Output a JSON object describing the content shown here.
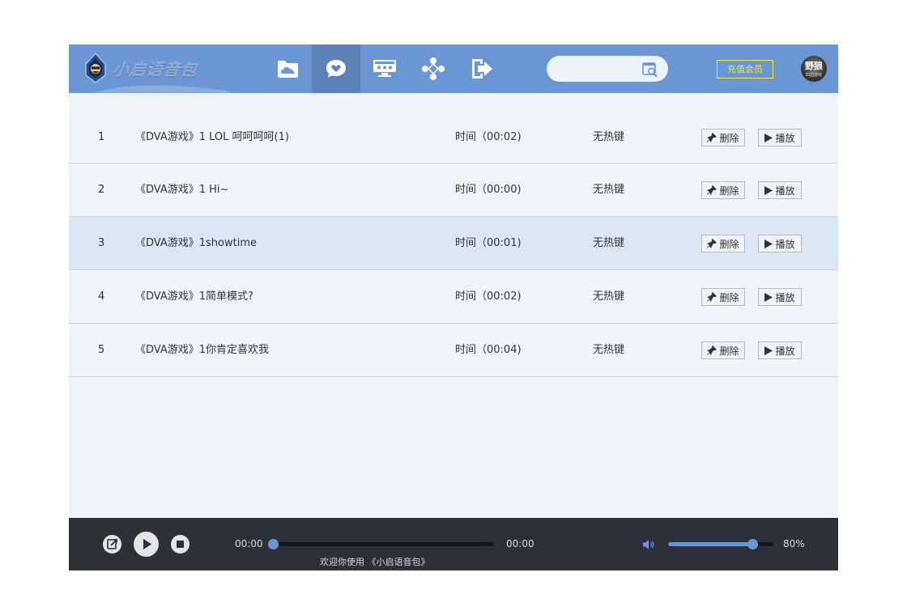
{
  "header": {
    "logo_text": "小启语音包",
    "nav": [
      {
        "icon": "cloud-folder-icon",
        "active": false
      },
      {
        "icon": "heart-chat-icon",
        "active": true
      },
      {
        "icon": "monitor-icon",
        "active": false
      },
      {
        "icon": "gamepad-icon",
        "active": false
      },
      {
        "icon": "exit-icon",
        "active": false
      }
    ],
    "search": {
      "value": "",
      "placeholder": ""
    },
    "recharge_label": "充值会员",
    "avatar_text": "野狼",
    "avatar_subtext": "四国游戏"
  },
  "list": {
    "rows": [
      {
        "index": "1",
        "name": "《DVA游戏》1 LOL 呵呵呵呵(1)",
        "time": "时间（00:02)",
        "hotkey": "无热键",
        "delete_label": "删除",
        "play_label": "播放"
      },
      {
        "index": "2",
        "name": "《DVA游戏》1 Hi~",
        "time": "时间（00:00)",
        "hotkey": "无热键",
        "delete_label": "删除",
        "play_label": "播放"
      },
      {
        "index": "3",
        "name": "《DVA游戏》1showtime",
        "time": "时间（00:01)",
        "hotkey": "无热键",
        "delete_label": "删除",
        "play_label": "播放"
      },
      {
        "index": "4",
        "name": "《DVA游戏》1简单模式?",
        "time": "时间（00:02)",
        "hotkey": "无热键",
        "delete_label": "删除",
        "play_label": "播放"
      },
      {
        "index": "5",
        "name": "《DVA游戏》1你肯定喜欢我",
        "time": "时间（00:04)",
        "hotkey": "无热键",
        "delete_label": "删除",
        "play_label": "播放"
      }
    ],
    "highlighted_row": 3
  },
  "player": {
    "current_time": "00:00",
    "total_time": "00:00",
    "progress": 0,
    "welcome_text": "欢迎你使用 《小启语音包》",
    "volume": 0.8,
    "volume_label": "80%"
  },
  "colors": {
    "header_bg": "#6a96d3",
    "nav_active_bg": "#5b83ba",
    "list_bg": "#eff4fb",
    "row_highlight": "#dae6f4",
    "player_bg": "#2c3038",
    "accent": "#6a96d3",
    "recharge": "#f6e83a"
  }
}
